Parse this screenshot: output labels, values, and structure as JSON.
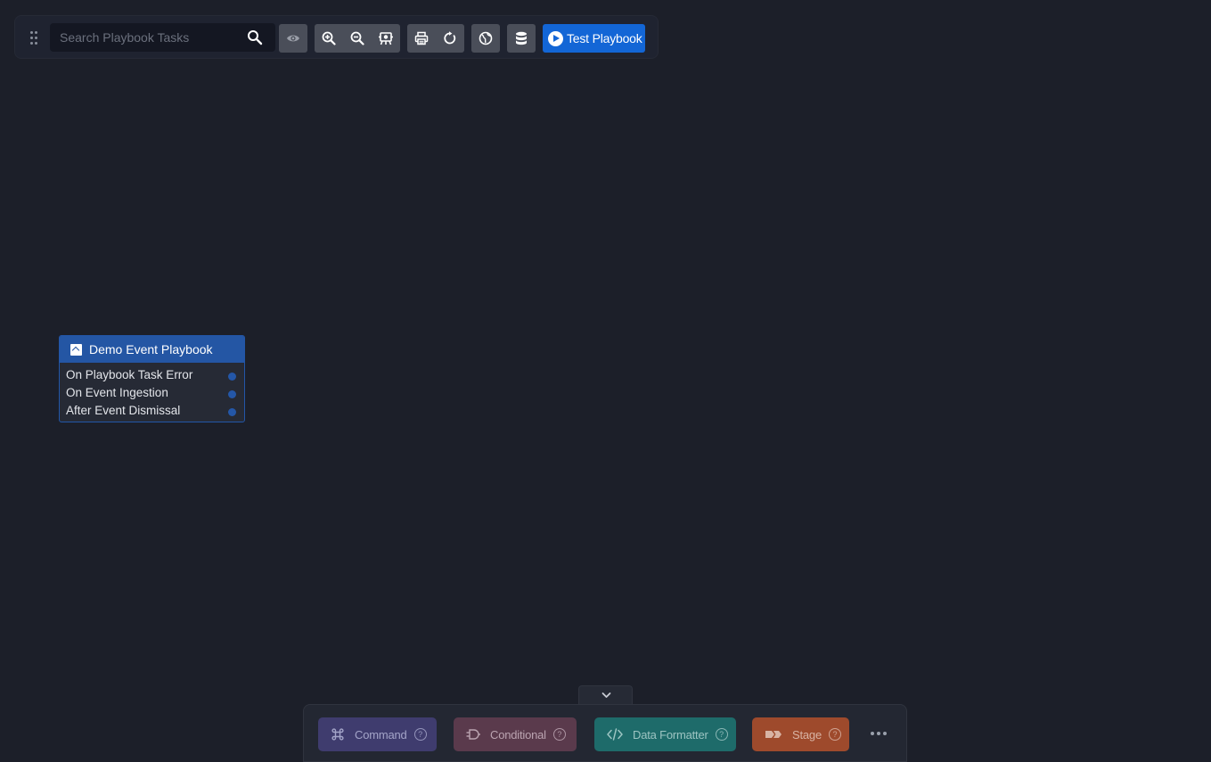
{
  "toolbar": {
    "search": {
      "placeholder": "Search Playbook Tasks",
      "value": ""
    },
    "buttons": {
      "visibility": "eye-icon",
      "zoom_in": "zoom-in-icon",
      "zoom_out": "zoom-out-icon",
      "fit_view": "fit-view-icon",
      "print": "printer-icon",
      "refresh": "refresh-icon",
      "globe": "globe-icon",
      "database": "database-icon"
    },
    "test_playbook_label": "Test Playbook"
  },
  "node": {
    "title": "Demo Event Playbook",
    "triggers": [
      {
        "label": "On Playbook Task Error"
      },
      {
        "label": "On Event Ingestion"
      },
      {
        "label": "After Event Dismissal"
      }
    ]
  },
  "palette": {
    "items": [
      {
        "label": "Command",
        "icon": "command-icon",
        "bg": "#3f3c6e",
        "fg": "#a3a4c8"
      },
      {
        "label": "Conditional",
        "icon": "conditional-icon",
        "bg": "#5a3a4c",
        "fg": "#bba4b1"
      },
      {
        "label": "Data Formatter",
        "icon": "code-icon",
        "bg": "#1e6b6a",
        "fg": "#9cc4c2"
      },
      {
        "label": "Stage",
        "icon": "stage-icon",
        "bg": "#9e4a2c",
        "fg": "#d8b3a4"
      }
    ],
    "help_glyph": "?"
  },
  "colors": {
    "background": "#1c1f29",
    "accent": "#1366d6",
    "node_header": "#2456a4"
  }
}
